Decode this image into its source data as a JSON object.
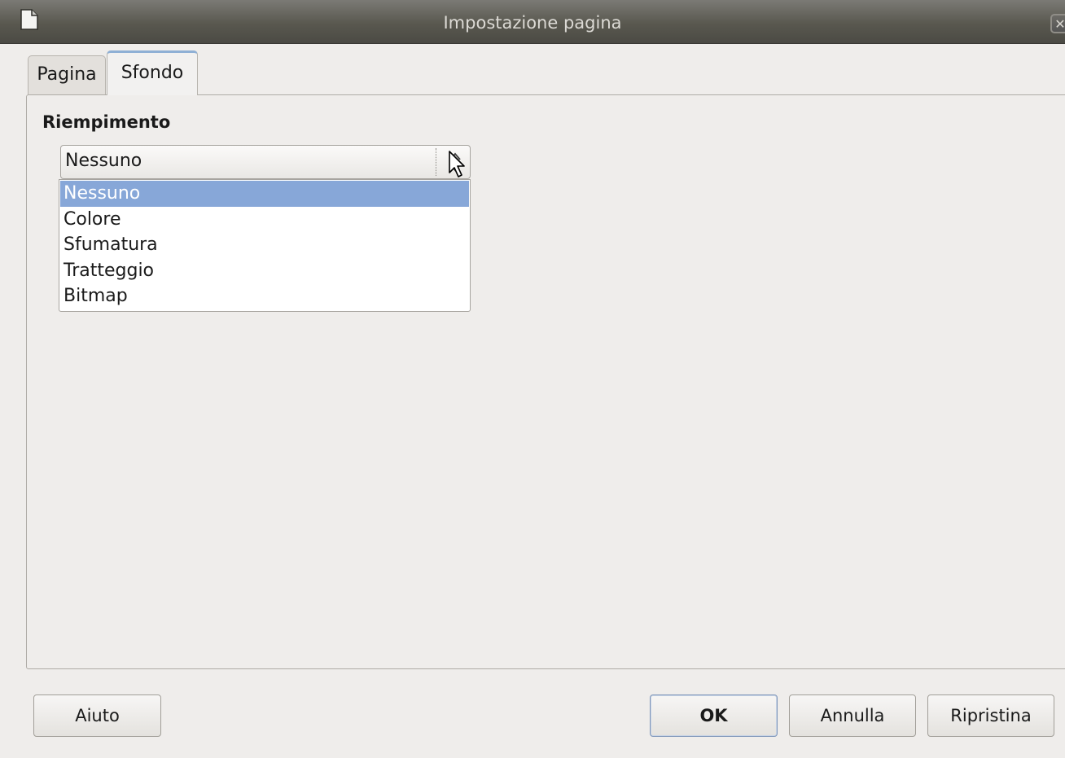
{
  "window": {
    "title": "Impostazione pagina",
    "close_icon_glyph": "✕"
  },
  "tabs": [
    {
      "label": "Pagina",
      "active": false
    },
    {
      "label": "Sfondo",
      "active": true
    }
  ],
  "fill": {
    "section_label": "Riempimento",
    "selected_value": "Nessuno",
    "options": [
      "Nessuno",
      "Colore",
      "Sfumatura",
      "Tratteggio",
      "Bitmap"
    ],
    "highlighted_option": "Nessuno"
  },
  "buttons": {
    "help": "Aiuto",
    "ok": "OK",
    "cancel": "Annulla",
    "reset": "Ripristina"
  },
  "colors": {
    "highlight": "#87a7d8",
    "titlebar": "#59584f",
    "dialog_bg": "#efedeb"
  }
}
